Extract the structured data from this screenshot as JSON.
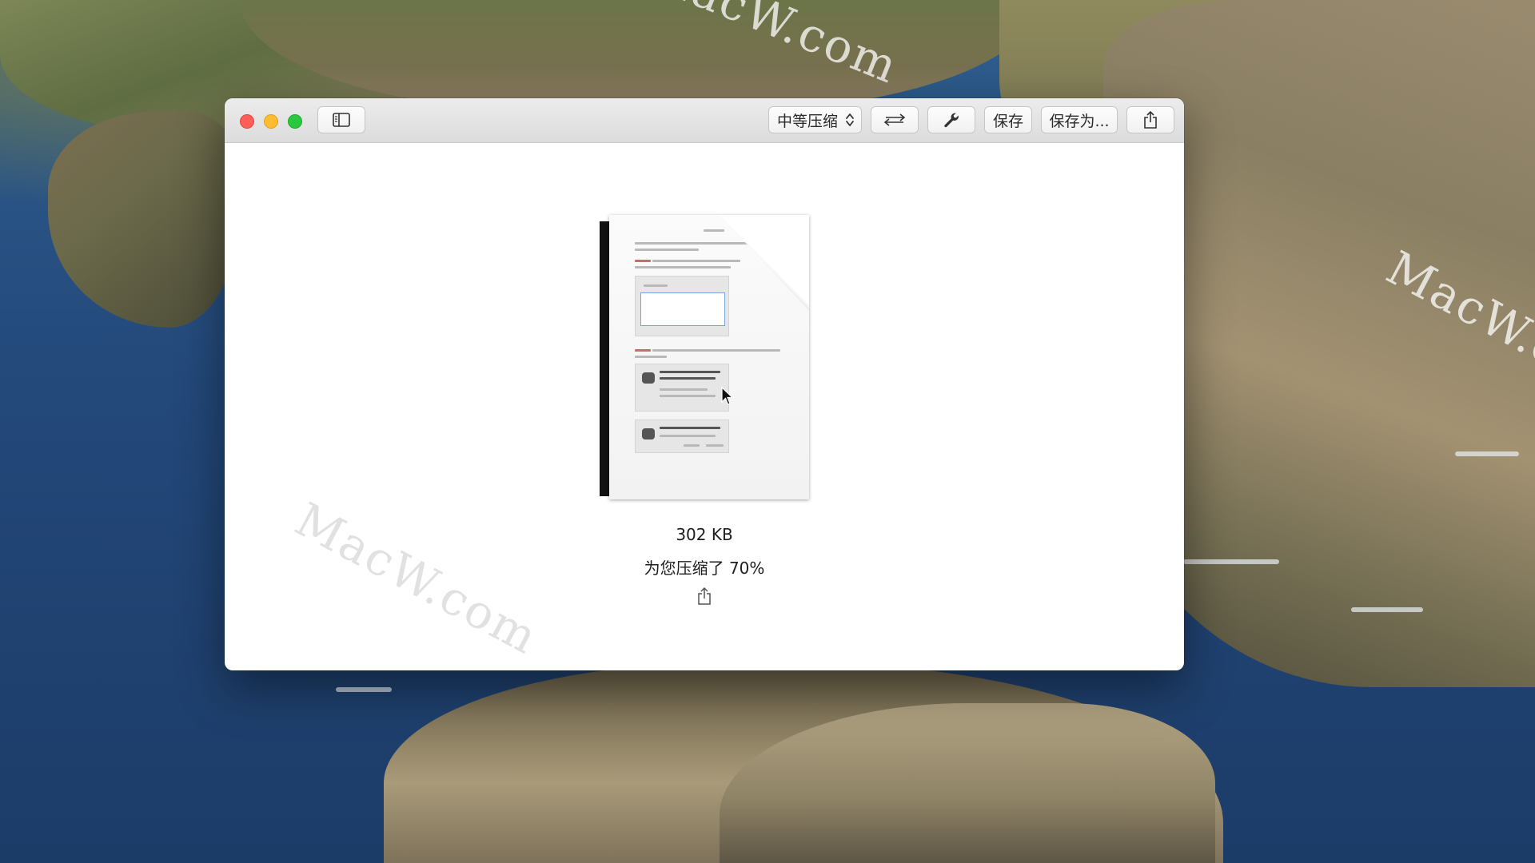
{
  "desktop": {
    "watermark_text": "MacW.com"
  },
  "window": {
    "traffic_lights": {
      "close_color": "#fe5f57",
      "minimize_color": "#febc2e",
      "maximize_color": "#28c840"
    },
    "toolbar": {
      "sidebar_icon": "sidebar-toggle-icon",
      "compression_select": {
        "label": "中等压缩",
        "icon": "up-down-chevron-icon"
      },
      "swap_icon": "swap-arrows-icon",
      "tools_icon": "wrench-icon",
      "save_label": "保存",
      "save_as_label": "保存为...",
      "share_icon": "share-icon"
    },
    "result": {
      "file_size": "302 KB",
      "compression_message": "为您压缩了 70%",
      "share_icon": "share-icon"
    }
  }
}
